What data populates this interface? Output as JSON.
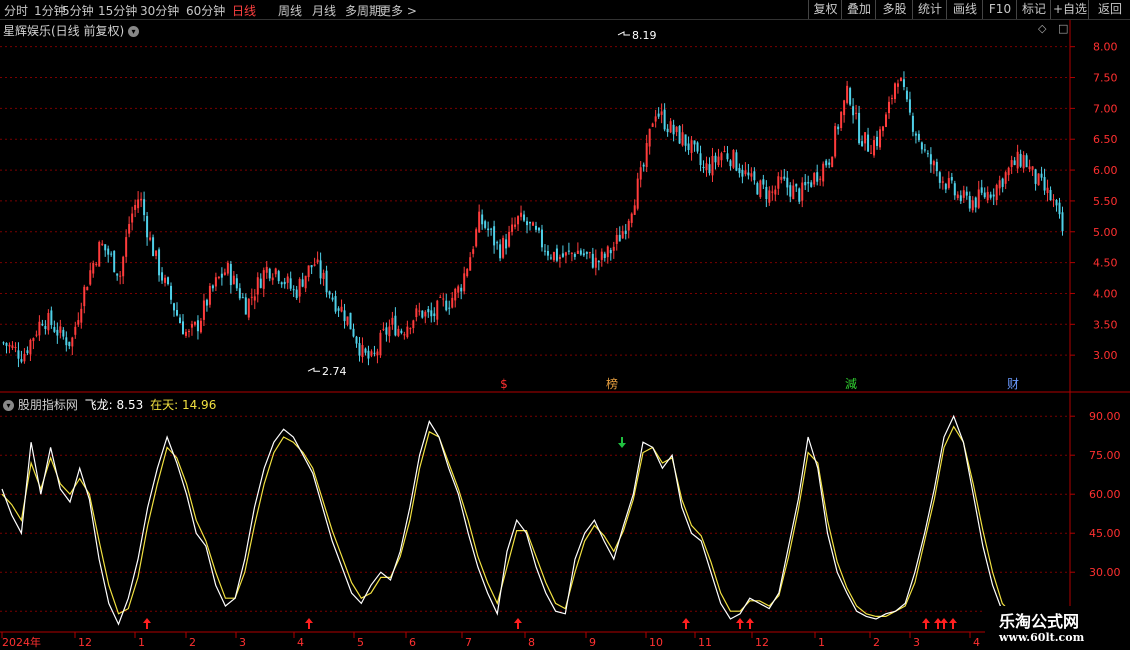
{
  "toolbar": {
    "periods": [
      "分时",
      "1分钟",
      "5分钟",
      "15分钟",
      "30分钟",
      "60分钟",
      "日线",
      "周线",
      "月线",
      "多周期",
      "更多 >"
    ],
    "active_period": "日线",
    "right_buttons": [
      "复权",
      "叠加",
      "多股",
      "统计",
      "画线",
      "F10",
      "标记",
      "+自选",
      "返回"
    ]
  },
  "main_panel": {
    "title": "星辉娱乐(日线 前复权)",
    "high_label": "8.19",
    "low_label": "2.74",
    "markers": [
      {
        "text": "$",
        "color": "#ff3030"
      },
      {
        "text": "榜",
        "color": "#e8a040"
      },
      {
        "text": "減",
        "color": "#30d030"
      },
      {
        "text": "财",
        "color": "#6a9aff"
      }
    ]
  },
  "indicator_panel": {
    "name": "股朋指标网",
    "series1_label": "飞龙:",
    "series1_value": "8.53",
    "series2_label": "在天:",
    "series2_value": "14.96"
  },
  "time_axis": {
    "labels": [
      "2024年",
      "12",
      "1",
      "2",
      "3",
      "4",
      "5",
      "6",
      "7",
      "8",
      "9",
      "10",
      "11",
      "12",
      "1",
      "2",
      "3",
      "4"
    ]
  },
  "watermark": {
    "line1": "乐淘公式网",
    "line2": "www.60lt.com"
  },
  "colors": {
    "up": "#ff3c3c",
    "down": "#4fd0e8",
    "grid": "#7a0000",
    "axis": "#b00000",
    "line_white": "#ffffff",
    "line_yellow": "#f0e040",
    "arrow_red": "#ff2020",
    "arrow_green": "#20c040"
  },
  "chart_data": [
    {
      "type": "candlestick",
      "title": "星辉娱乐(日线 前复权)",
      "ylim": [
        2.5,
        8.4
      ],
      "yticks": [
        3.0,
        3.5,
        4.0,
        4.5,
        5.0,
        5.5,
        6.0,
        6.5,
        7.0,
        7.5,
        8.0
      ],
      "annotations": [
        {
          "label": "8.19",
          "type": "high"
        },
        {
          "label": "2.74",
          "type": "low"
        }
      ],
      "close_path": [
        3.2,
        3.1,
        3.0,
        3.3,
        3.6,
        3.5,
        3.3,
        3.2,
        3.9,
        4.4,
        4.8,
        4.6,
        4.3,
        5.2,
        5.6,
        4.9,
        4.4,
        4.0,
        3.6,
        3.3,
        3.5,
        3.9,
        4.2,
        4.4,
        4.1,
        3.8,
        4.1,
        4.4,
        4.4,
        4.2,
        4.0,
        4.3,
        4.5,
        4.2,
        3.9,
        3.7,
        3.4,
        3.0,
        2.9,
        3.3,
        3.5,
        3.4,
        3.6,
        3.7,
        3.6,
        3.8,
        3.9,
        4.1,
        4.6,
        5.2,
        5.0,
        4.7,
        4.9,
        5.2,
        5.1,
        4.9,
        4.7,
        4.6,
        4.6,
        4.7,
        4.6,
        4.5,
        4.6,
        4.8,
        5.1,
        5.6,
        6.1,
        7.0,
        6.8,
        6.6,
        6.5,
        6.3,
        6.0,
        6.1,
        6.3,
        6.2,
        6.0,
        5.8,
        5.7,
        5.6,
        5.8,
        5.7,
        5.6,
        5.8,
        6.0,
        6.2,
        6.8,
        7.3,
        6.6,
        6.4,
        6.5,
        6.9,
        7.6,
        7.0,
        6.6,
        6.2,
        6.0,
        5.8,
        5.6,
        5.5,
        5.5,
        5.6,
        5.7,
        5.9,
        6.1,
        6.2,
        5.9,
        5.7,
        5.5,
        5.0
      ]
    },
    {
      "type": "line",
      "title": "股朋指标网",
      "ylim": [
        7,
        97
      ],
      "yticks": [
        15.0,
        30.0,
        45.0,
        60.0,
        75.0,
        90.0
      ],
      "series": [
        {
          "name": "飞龙",
          "values": [
            62,
            52,
            45,
            80,
            60,
            78,
            62,
            57,
            70,
            58,
            35,
            18,
            10,
            20,
            35,
            55,
            70,
            82,
            72,
            60,
            45,
            40,
            25,
            17,
            20,
            35,
            55,
            70,
            80,
            85,
            82,
            75,
            68,
            55,
            42,
            32,
            22,
            18,
            25,
            30,
            27,
            38,
            55,
            75,
            88,
            82,
            70,
            60,
            45,
            32,
            22,
            14,
            38,
            50,
            45,
            32,
            22,
            15,
            14,
            35,
            45,
            50,
            42,
            35,
            48,
            60,
            80,
            78,
            70,
            75,
            55,
            45,
            42,
            30,
            18,
            12,
            14,
            20,
            18,
            16,
            22,
            40,
            58,
            82,
            70,
            45,
            30,
            22,
            15,
            13,
            12,
            14,
            15,
            18,
            30,
            45,
            62,
            82,
            90,
            80,
            60,
            40,
            25,
            15,
            12
          ]
        },
        {
          "name": "在天",
          "values": [
            60,
            56,
            50,
            72,
            62,
            74,
            64,
            60,
            66,
            60,
            42,
            25,
            14,
            16,
            28,
            48,
            64,
            78,
            74,
            64,
            50,
            42,
            30,
            20,
            20,
            30,
            48,
            64,
            76,
            82,
            80,
            76,
            70,
            58,
            46,
            36,
            26,
            20,
            22,
            28,
            28,
            36,
            50,
            70,
            84,
            82,
            72,
            62,
            50,
            36,
            26,
            18,
            32,
            46,
            46,
            36,
            26,
            18,
            16,
            30,
            42,
            48,
            44,
            38,
            46,
            58,
            76,
            78,
            72,
            74,
            58,
            48,
            44,
            34,
            22,
            15,
            15,
            19,
            19,
            17,
            21,
            36,
            54,
            76,
            72,
            50,
            34,
            24,
            17,
            14,
            13,
            13,
            15,
            17,
            26,
            42,
            58,
            78,
            86,
            80,
            64,
            46,
            30,
            18,
            14
          ]
        }
      ]
    }
  ]
}
